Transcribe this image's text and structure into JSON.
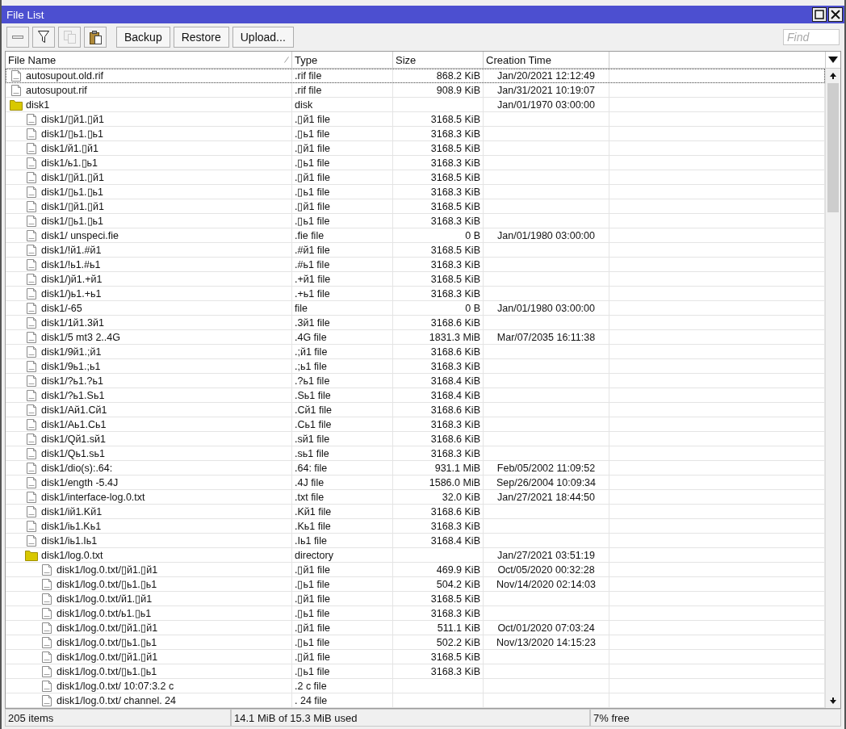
{
  "window": {
    "title": "File List"
  },
  "toolbar": {
    "icon_buttons": [
      {
        "kind": "remove",
        "disabled": false
      },
      {
        "kind": "filter",
        "disabled": false
      },
      {
        "kind": "copy",
        "disabled": true
      },
      {
        "kind": "paste",
        "disabled": false
      }
    ],
    "buttons": [
      "Backup",
      "Restore",
      "Upload..."
    ],
    "search": {
      "placeholder": "Find"
    }
  },
  "table": {
    "columns": [
      {
        "label": "File Name",
        "sorted": true
      },
      {
        "label": "Type",
        "sorted": false
      },
      {
        "label": "Size",
        "sorted": false
      },
      {
        "label": "Creation Time",
        "sorted": false
      }
    ],
    "rows": [
      {
        "kind": "file",
        "name": "autosupout.old.rif",
        "type": ".rif file",
        "size": "868.2 KiB",
        "time": "Jan/20/2021 12:12:49",
        "selected": true
      },
      {
        "kind": "file",
        "name": "autosupout.rif",
        "type": ".rif file",
        "size": "908.9 KiB",
        "time": "Jan/31/2021 10:19:07",
        "selected": false
      },
      {
        "kind": "folder",
        "name": "disk1",
        "type": "disk",
        "time": "Jan/01/1970 03:00:00",
        "selected": false,
        "children": [
          {
            "kind": "file",
            "name": "disk1/▯й1.▯й1",
            "type": ".▯й1 file",
            "size": "3168.5 KiB",
            "selected": false
          },
          {
            "kind": "file",
            "name": "disk1/▯ь1.▯ь1",
            "type": ".▯ь1 file",
            "size": "3168.3 KiB",
            "selected": false
          },
          {
            "kind": "file",
            "name": "disk1/й1.▯й1",
            "type": ".▯й1 file",
            "size": "3168.5 KiB",
            "selected": false
          },
          {
            "kind": "file",
            "name": "disk1/ь1.▯ь1",
            "type": ".▯ь1 file",
            "size": "3168.3 KiB",
            "selected": false
          },
          {
            "kind": "file",
            "name": "disk1/▯й1.▯й1",
            "type": ".▯й1 file",
            "size": "3168.5 KiB",
            "selected": false
          },
          {
            "kind": "file",
            "name": "disk1/▯ь1.▯ь1",
            "type": ".▯ь1 file",
            "size": "3168.3 KiB",
            "selected": false
          },
          {
            "kind": "file",
            "name": "disk1/▯й1.▯й1",
            "type": ".▯й1 file",
            "size": "3168.5 KiB",
            "selected": false
          },
          {
            "kind": "file",
            "name": "disk1/▯ь1.▯ь1",
            "type": ".▯ь1 file",
            "size": "3168.3 KiB",
            "selected": false
          },
          {
            "kind": "file",
            "name": "disk1/ unspeci.fie",
            "type": ".fie file",
            "size": "0 B",
            "time": "Jan/01/1980 03:00:00",
            "selected": false
          },
          {
            "kind": "file",
            "name": "disk1/!й1.#й1",
            "type": ".#й1 file",
            "size": "3168.5 KiB",
            "selected": false
          },
          {
            "kind": "file",
            "name": "disk1/!ь1.#ь1",
            "type": ".#ь1 file",
            "size": "3168.3 KiB",
            "selected": false
          },
          {
            "kind": "file",
            "name": "disk1/)й1.+й1",
            "type": ".+й1 file",
            "size": "3168.5 KiB",
            "selected": false
          },
          {
            "kind": "file",
            "name": "disk1/)ь1.+ь1",
            "type": ".+ь1 file",
            "size": "3168.3 KiB",
            "selected": false
          },
          {
            "kind": "file",
            "name": "disk1/-65",
            "type": "file",
            "size": "0 B",
            "time": "Jan/01/1980 03:00:00",
            "selected": false
          },
          {
            "kind": "file",
            "name": "disk1/1й1.3й1",
            "type": ".3й1 file",
            "size": "3168.6 KiB",
            "selected": false
          },
          {
            "kind": "file",
            "name": "disk1/5 mt3 2..4G",
            "type": ".4G file",
            "size": "1831.3 MiB",
            "time": "Mar/07/2035 16:11:38",
            "selected": false
          },
          {
            "kind": "file",
            "name": "disk1/9й1.;й1",
            "type": ".;й1 file",
            "size": "3168.6 KiB",
            "selected": false
          },
          {
            "kind": "file",
            "name": "disk1/9ь1.;ь1",
            "type": ".;ь1 file",
            "size": "3168.3 KiB",
            "selected": false
          },
          {
            "kind": "file",
            "name": "disk1/?ь1.?ь1",
            "type": ".?ь1 file",
            "size": "3168.4 KiB",
            "selected": false
          },
          {
            "kind": "file",
            "name": "disk1/?ь1.Sь1",
            "type": ".Sь1 file",
            "size": "3168.4 KiB",
            "selected": false
          },
          {
            "kind": "file",
            "name": "disk1/Aй1.Cй1",
            "type": ".Cй1 file",
            "size": "3168.6 KiB",
            "selected": false
          },
          {
            "kind": "file",
            "name": "disk1/Aь1.Cь1",
            "type": ".Cь1 file",
            "size": "3168.3 KiB",
            "selected": false
          },
          {
            "kind": "file",
            "name": "disk1/Qй1.sй1",
            "type": ".sй1 file",
            "size": "3168.6 KiB",
            "selected": false
          },
          {
            "kind": "file",
            "name": "disk1/Qь1.sь1",
            "type": ".sь1 file",
            "size": "3168.3 KiB",
            "selected": false
          },
          {
            "kind": "file",
            "name": "disk1/dio(s):.64:",
            "type": ".64: file",
            "size": "931.1 MiB",
            "time": "Feb/05/2002 11:09:52",
            "selected": false
          },
          {
            "kind": "file",
            "name": "disk1/ength -5.4J",
            "type": ".4J file",
            "size": "1586.0 MiB",
            "time": "Sep/26/2004 10:09:34",
            "selected": false
          },
          {
            "kind": "file",
            "name": "disk1/interface-log.0.txt",
            "type": ".txt file",
            "size": "32.0 KiB",
            "time": "Jan/27/2021 18:44:50",
            "selected": false
          },
          {
            "kind": "file",
            "name": "disk1/iй1.Kй1",
            "type": ".Kй1 file",
            "size": "3168.6 KiB",
            "selected": false
          },
          {
            "kind": "file",
            "name": "disk1/iь1.Kь1",
            "type": ".Kь1 file",
            "size": "3168.3 KiB",
            "selected": false
          },
          {
            "kind": "file",
            "name": "disk1/iь1.Iь1",
            "type": ".Iь1 file",
            "size": "3168.4 KiB",
            "selected": false
          },
          {
            "kind": "folder",
            "name": "disk1/log.0.txt",
            "type": "directory",
            "time": "Jan/27/2021 03:51:19",
            "selected": false,
            "children": [
              {
                "kind": "file",
                "name": "disk1/log.0.txt/▯й1.▯й1",
                "type": ".▯й1 file",
                "size": "469.9 KiB",
                "time": "Oct/05/2020 00:32:28",
                "selected": false
              },
              {
                "kind": "file",
                "name": "disk1/log.0.txt/▯ь1.▯ь1",
                "type": ".▯ь1 file",
                "size": "504.2 KiB",
                "time": "Nov/14/2020 02:14:03",
                "selected": false
              },
              {
                "kind": "file",
                "name": "disk1/log.0.txt/й1.▯й1",
                "type": ".▯й1 file",
                "size": "3168.5 KiB",
                "selected": false
              },
              {
                "kind": "file",
                "name": "disk1/log.0.txt/ь1.▯ь1",
                "type": ".▯ь1 file",
                "size": "3168.3 KiB",
                "selected": false
              },
              {
                "kind": "file",
                "name": "disk1/log.0.txt/▯й1.▯й1",
                "type": ".▯й1 file",
                "size": "511.1 KiB",
                "time": "Oct/01/2020 07:03:24",
                "selected": false
              },
              {
                "kind": "file",
                "name": "disk1/log.0.txt/▯ь1.▯ь1",
                "type": ".▯ь1 file",
                "size": "502.2 KiB",
                "time": "Nov/13/2020 14:15:23",
                "selected": false
              },
              {
                "kind": "file",
                "name": "disk1/log.0.txt/▯й1.▯й1",
                "type": ".▯й1 file",
                "size": "3168.5 KiB",
                "selected": false
              },
              {
                "kind": "file",
                "name": "disk1/log.0.txt/▯ь1.▯ь1",
                "type": ".▯ь1 file",
                "size": "3168.3 KiB",
                "selected": false
              },
              {
                "kind": "file",
                "name": "disk1/log.0.txt/ 10:07:3.2 c",
                "type": ".2 c file",
                "selected": false
              },
              {
                "kind": "file",
                "name": "disk1/log.0.txt/ channel. 24",
                "type": ". 24 file",
                "selected": false
              }
            ]
          }
        ]
      }
    ]
  },
  "status_bar": [
    "205 items",
    "14.1 MiB of 15.3 MiB used",
    "7% free"
  ]
}
